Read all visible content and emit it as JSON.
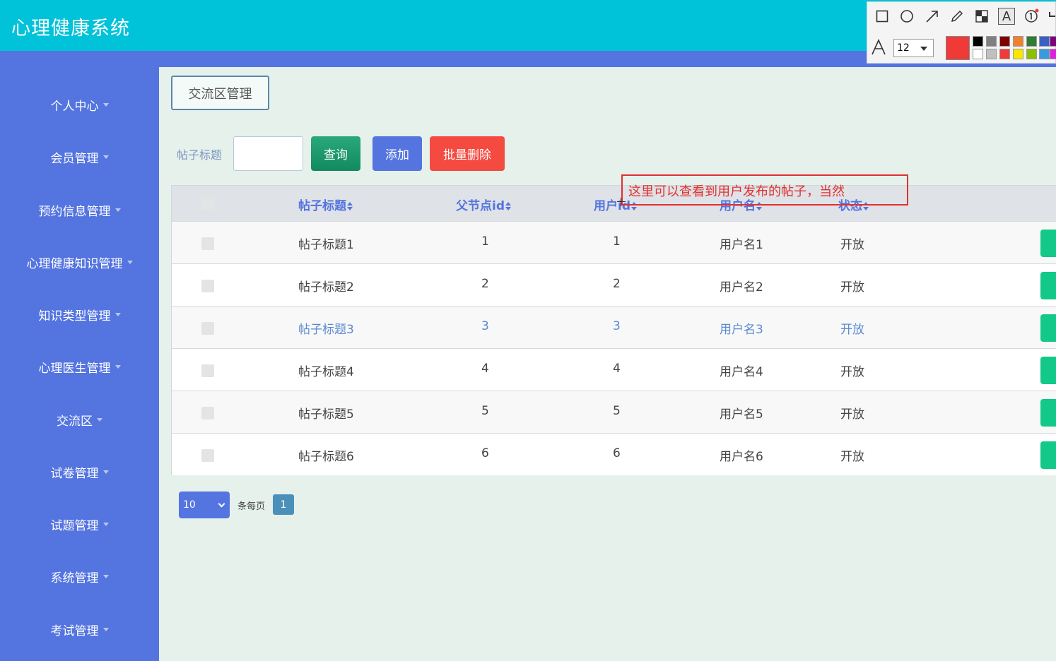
{
  "app": {
    "title": "心理健康系统"
  },
  "sidebar": {
    "items": [
      {
        "label": "个人中心"
      },
      {
        "label": "会员管理"
      },
      {
        "label": "预约信息管理"
      },
      {
        "label": "心理健康知识管理"
      },
      {
        "label": "知识类型管理"
      },
      {
        "label": "心理医生管理"
      },
      {
        "label": "交流区"
      },
      {
        "label": "试卷管理"
      },
      {
        "label": "试题管理"
      },
      {
        "label": "系统管理"
      },
      {
        "label": "考试管理"
      }
    ]
  },
  "breadcrumb": {
    "label": "交流区管理"
  },
  "search": {
    "label": "帖子标题",
    "value": "",
    "query_label": "查询",
    "add_label": "添加",
    "batch_delete_label": "批量删除"
  },
  "table": {
    "columns": [
      "帖子标题",
      "父节点id",
      "用户id",
      "用户名",
      "状态"
    ],
    "rows": [
      [
        "帖子标题1",
        "1",
        "1",
        "用户名1",
        "开放"
      ],
      [
        "帖子标题2",
        "2",
        "2",
        "用户名2",
        "开放"
      ],
      [
        "帖子标题3",
        "3",
        "3",
        "用户名3",
        "开放"
      ],
      [
        "帖子标题4",
        "4",
        "4",
        "用户名4",
        "开放"
      ],
      [
        "帖子标题5",
        "5",
        "5",
        "用户名5",
        "开放"
      ],
      [
        "帖子标题6",
        "6",
        "6",
        "用户名6",
        "开放"
      ]
    ]
  },
  "pagination": {
    "page_size": "10",
    "per_page_label": "条每页",
    "current_page": "1"
  },
  "annotation": {
    "text": "这里可以查看到用户发布的帖子，当然",
    "color": "#e03030"
  },
  "drawing_toolbar": {
    "tools": [
      "rectangle-icon",
      "circle-icon",
      "arrow-icon",
      "pencil-icon",
      "mosaic-icon",
      "text-icon",
      "number-icon"
    ],
    "text_tool_glyph": "A",
    "font_size": "12",
    "current_color": "#f03a38",
    "palette_row1": [
      "#000000",
      "#808080",
      "#800000",
      "#f08030",
      "#2e7d32",
      "#3a5fc8",
      "#800080"
    ],
    "palette_row2": [
      "#ffffff",
      "#c0c0c0",
      "#f03a38",
      "#f8e800",
      "#8cc000",
      "#3a9ae0",
      "#e020e0"
    ]
  },
  "colors": {
    "header": "#00c2d9",
    "sidebar": "#5474e0",
    "accent_green": "#12c98a",
    "danger": "#f44a40"
  }
}
